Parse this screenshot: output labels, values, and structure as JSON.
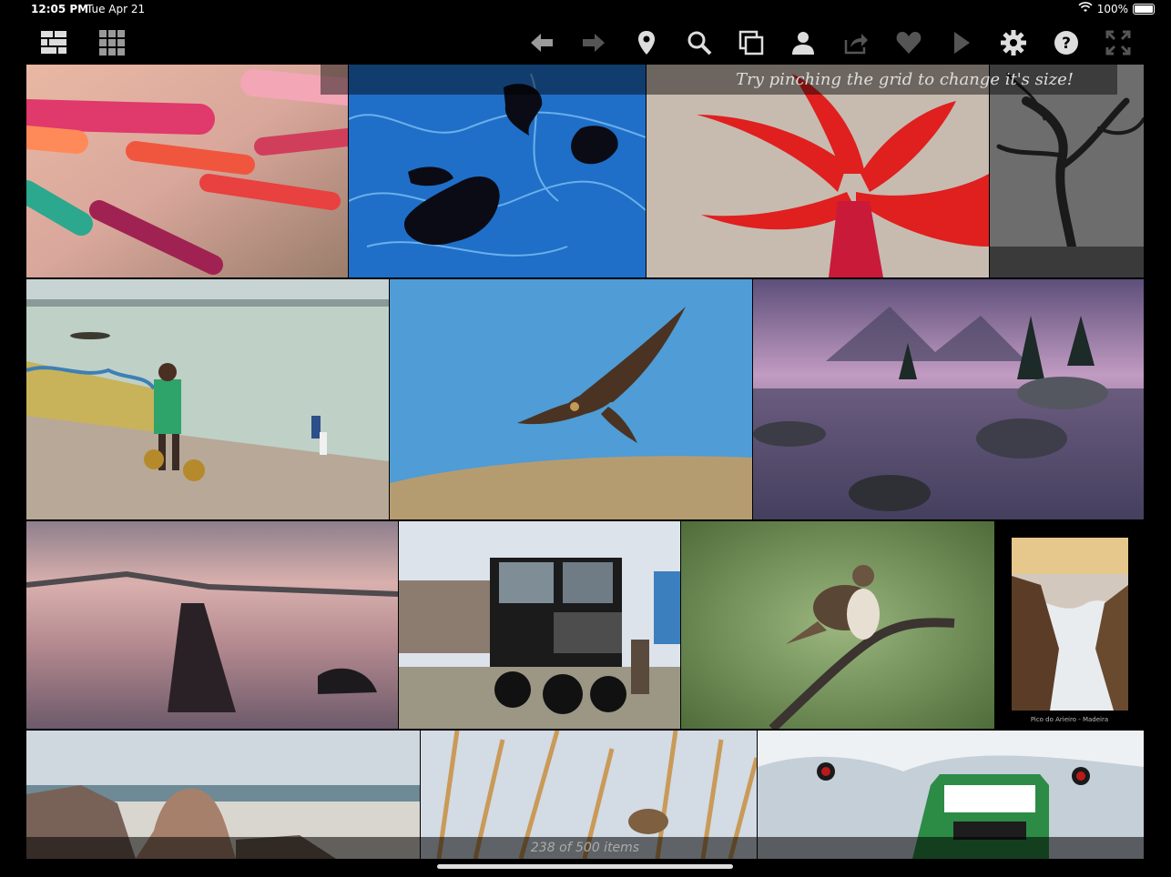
{
  "status": {
    "time": "12:05 PM",
    "date": "Tue Apr 21",
    "battery": "100%"
  },
  "toolbar": {
    "icons": [
      "brick-layout-icon",
      "square-grid-icon",
      "back-arrow-icon",
      "forward-arrow-icon",
      "location-pin-icon",
      "search-icon",
      "copy-icon",
      "person-icon",
      "share-icon",
      "heart-icon",
      "play-icon",
      "gear-icon",
      "help-icon",
      "fullscreen-icon"
    ]
  },
  "hint": "Try pinching the grid to change it's size!",
  "footer": {
    "count": "238 of 500 items"
  },
  "photos": [
    {
      "name": "colored-straws"
    },
    {
      "name": "blue-ice-leaves"
    },
    {
      "name": "red-flower"
    },
    {
      "name": "bw-tree"
    },
    {
      "name": "river-ghat-man"
    },
    {
      "name": "eagle-in-flight"
    },
    {
      "name": "mountain-lake-purple"
    },
    {
      "name": "misty-pier-sunset"
    },
    {
      "name": "mack-truck"
    },
    {
      "name": "hawk-on-branch"
    },
    {
      "name": "madeira-print",
      "caption": "Pico do Arieiro - Madeira"
    },
    {
      "name": "rocky-coast"
    },
    {
      "name": "reeds-bird"
    },
    {
      "name": "green-train"
    }
  ]
}
